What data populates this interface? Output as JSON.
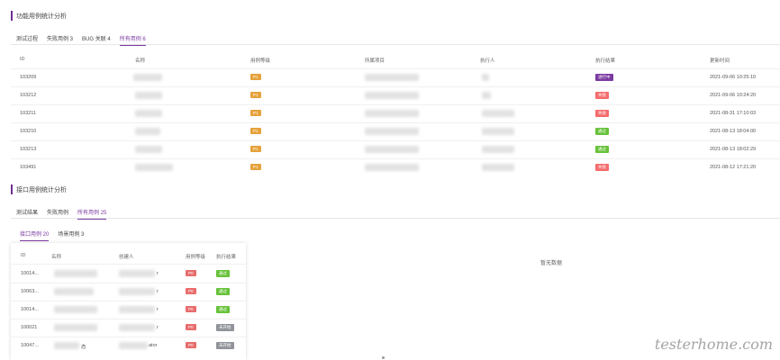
{
  "interface_section": {
    "title": "功能用例统计分析",
    "tabs": [
      {
        "label": "测试过程"
      },
      {
        "label": "失败用例 3"
      },
      {
        "label": "BUG 关联 4"
      },
      {
        "label": "所有用例 6"
      }
    ],
    "columns": [
      "ID",
      "名称",
      "用例等级",
      "所属项目",
      "执行人",
      "执行结果",
      "更新时间"
    ],
    "rows": [
      {
        "id": "103209",
        "priority": "P1",
        "status": "进行中",
        "status_type": "running",
        "updated": "2021-09-06 10:25:10"
      },
      {
        "id": "103212",
        "priority": "P1",
        "status": "失败",
        "status_type": "fail",
        "updated": "2021-09-06 10:24:20"
      },
      {
        "id": "103211",
        "priority": "P1",
        "status": "失败",
        "status_type": "fail",
        "updated": "2021-08-31 17:10:03"
      },
      {
        "id": "103210",
        "priority": "P1",
        "status": "通过",
        "status_type": "pass",
        "updated": "2021-08-13 18:04:00"
      },
      {
        "id": "103213",
        "priority": "P1",
        "status": "通过",
        "status_type": "pass",
        "updated": "2021-08-13 18:02:29"
      },
      {
        "id": "103491",
        "priority": "P1",
        "status": "失败",
        "status_type": "fail",
        "updated": "2021-08-12 17:21:20"
      }
    ]
  },
  "api_section": {
    "title": "接口用例统计分析",
    "tabs": [
      {
        "label": "测试结果"
      },
      {
        "label": "失败用例"
      },
      {
        "label": "所有用例 25"
      }
    ],
    "subtabs": [
      {
        "label": "接口用例 20"
      },
      {
        "label": "场景用例 3"
      }
    ],
    "columns": [
      "ID",
      "名称",
      "创建人",
      "用例等级",
      "执行结果"
    ],
    "rows": [
      {
        "id": "10014...",
        "creator_suffix": "r",
        "priority": "P0",
        "status": "通过",
        "status_type": "pass"
      },
      {
        "id": "10063...",
        "creator_suffix": "r",
        "priority": "P0",
        "status": "通过",
        "status_type": "pass"
      },
      {
        "id": "10014...",
        "creator_suffix": "r",
        "priority": "P0",
        "status": "通过",
        "status_type": "pass"
      },
      {
        "id": "100021",
        "creator_suffix": "r",
        "priority": "P0",
        "status": "未开始",
        "status_type": "notrun"
      },
      {
        "id": "10047...",
        "name_suffix": "态",
        "creator_suffix": "ator",
        "priority": "P0",
        "status": "未开始",
        "status_type": "notrun"
      }
    ],
    "empty_text": "暂无数据"
  },
  "watermark": "testerhome.com",
  "colors": {
    "accent": "#7a3aa0",
    "p1": "#e6a23c",
    "p0": "#e86c6c",
    "pass": "#67c23a",
    "fail": "#f56c6c",
    "running": "#7a3aa0",
    "notrun": "#909399"
  }
}
